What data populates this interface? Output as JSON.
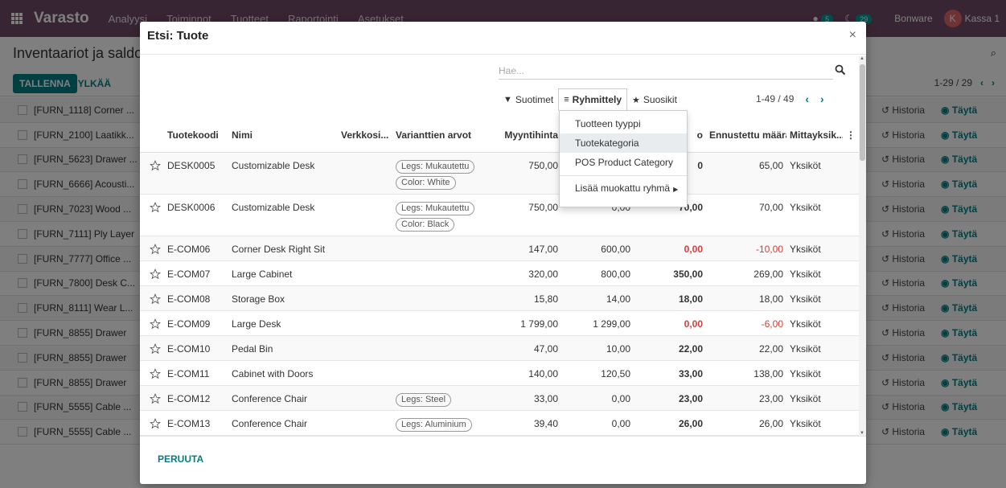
{
  "app": {
    "brand": "Varasto",
    "menu": [
      "Analyysi",
      "Toiminnot",
      "Tuotteet",
      "Raportointi",
      "Asetukset"
    ],
    "badge_activity": "5",
    "badge_messages": "29",
    "company": "Bonware",
    "avatar_letter": "K",
    "user": "Kassa 1"
  },
  "background": {
    "title": "Inventaariot ja saldot",
    "save_label": "TALLENNA",
    "discard_label": "HYLKÄÄ",
    "pager": "1-29 / 29",
    "history_label": "Historia",
    "fill_label": "Täytä",
    "rows": [
      "[FURN_1118] Corner ...",
      "[FURN_2100] Laatikk...",
      "[FURN_5623] Drawer ...",
      "[FURN_6666] Acousti...",
      "[FURN_7023] Wood ...",
      "[FURN_7111] Ply Layer",
      "[FURN_7777] Office ...",
      "[FURN_7800] Desk C...",
      "[FURN_8111] Wear L...",
      "[FURN_8855] Drawer",
      "[FURN_8855] Drawer",
      "[FURN_8855] Drawer",
      "[FURN_5555] Cable ...",
      "[FURN_5555] Cable ..."
    ]
  },
  "dialog": {
    "title": "Etsi: Tuote",
    "search_placeholder": "Hae...",
    "filters_label": "Suotimet",
    "groupby_label": "Ryhmittely",
    "favorites_label": "Suosikit",
    "pager": "1-49 / 49",
    "groupby_options": [
      "Tuotteen tyyppi",
      "Tuotekategoria",
      "POS Product Category"
    ],
    "custom_group_label": "Lisää muokattu ryhmä",
    "columns": [
      "Tuotekoodi",
      "Nimi",
      "Verkkosi...",
      "Varianttien arvot",
      "Myyntihinta",
      "K",
      "o",
      "Ennustettu määrä",
      "Mittayksik..."
    ],
    "rows": [
      {
        "code": "DESK0005",
        "name": "Customizable Desk",
        "tags": [
          "Legs: Mukautettu",
          "Color: White"
        ],
        "price": "750,00",
        "cost": "",
        "onhand": "0",
        "forecast": "65,00",
        "uom": "Yksiköt"
      },
      {
        "code": "DESK0006",
        "name": "Customizable Desk",
        "tags": [
          "Legs: Mukautettu",
          "Color: Black"
        ],
        "price": "750,00",
        "cost": "0,00",
        "onhand": "70,00",
        "forecast": "70,00",
        "uom": "Yksiköt"
      },
      {
        "code": "E-COM06",
        "name": "Corner Desk Right Sit",
        "tags": [],
        "price": "147,00",
        "cost": "600,00",
        "onhand": "0,00",
        "forecast": "-10,00",
        "uom": "Yksiköt"
      },
      {
        "code": "E-COM07",
        "name": "Large Cabinet",
        "tags": [],
        "price": "320,00",
        "cost": "800,00",
        "onhand": "350,00",
        "forecast": "269,00",
        "uom": "Yksiköt"
      },
      {
        "code": "E-COM08",
        "name": "Storage Box",
        "tags": [],
        "price": "15,80",
        "cost": "14,00",
        "onhand": "18,00",
        "forecast": "18,00",
        "uom": "Yksiköt"
      },
      {
        "code": "E-COM09",
        "name": "Large Desk",
        "tags": [],
        "price": "1 799,00",
        "cost": "1 299,00",
        "onhand": "0,00",
        "forecast": "-6,00",
        "uom": "Yksiköt"
      },
      {
        "code": "E-COM10",
        "name": "Pedal Bin",
        "tags": [],
        "price": "47,00",
        "cost": "10,00",
        "onhand": "22,00",
        "forecast": "22,00",
        "uom": "Yksiköt"
      },
      {
        "code": "E-COM11",
        "name": "Cabinet with Doors",
        "tags": [],
        "price": "140,00",
        "cost": "120,50",
        "onhand": "33,00",
        "forecast": "138,00",
        "uom": "Yksiköt"
      },
      {
        "code": "E-COM12",
        "name": "Conference Chair",
        "tags": [
          "Legs: Steel"
        ],
        "price": "33,00",
        "cost": "0,00",
        "onhand": "23,00",
        "forecast": "23,00",
        "uom": "Yksiköt"
      },
      {
        "code": "E-COM13",
        "name": "Conference Chair",
        "tags": [
          "Legs: Aluminium"
        ],
        "price": "39,40",
        "cost": "0,00",
        "onhand": "26,00",
        "forecast": "26,00",
        "uom": "Yksiköt"
      }
    ],
    "cancel_label": "PERUUTA"
  },
  "colors": {
    "topbar": "#714b67",
    "accent": "#017e84",
    "negative": "#d23f3a"
  }
}
